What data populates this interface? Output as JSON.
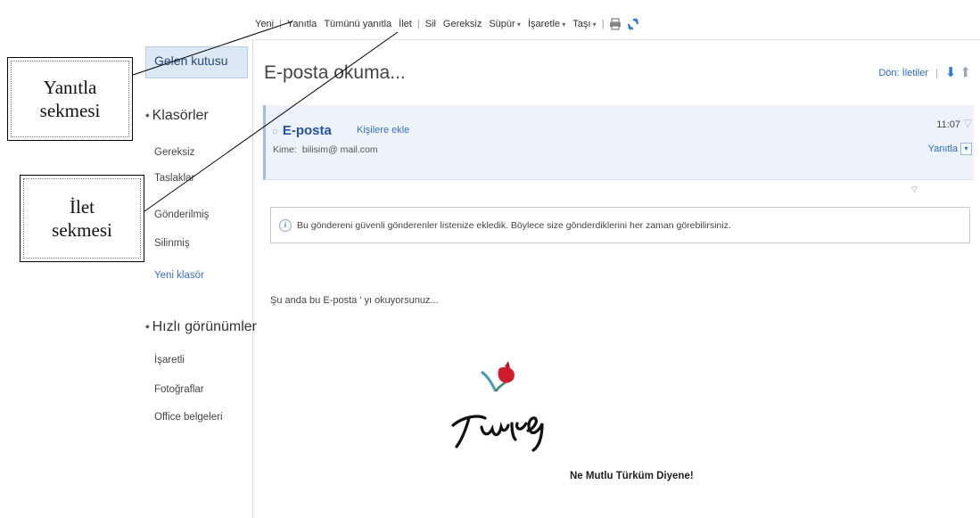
{
  "toolbar": {
    "items": [
      {
        "label": "Yeni",
        "dropdown": false
      },
      {
        "label": "Yanıtla",
        "dropdown": false
      },
      {
        "label": "Tümünü yanıtla",
        "dropdown": false
      },
      {
        "label": "İlet",
        "dropdown": false
      },
      {
        "label": "Sil",
        "dropdown": false
      },
      {
        "label": "Gereksiz",
        "dropdown": false
      },
      {
        "label": "Süpür",
        "dropdown": true
      },
      {
        "label": "İşaretle",
        "dropdown": true
      },
      {
        "label": "Taşı",
        "dropdown": true
      }
    ],
    "icons": [
      "printer-icon",
      "refresh-icon"
    ]
  },
  "nav": {
    "inbox": "Gelen kutusu",
    "folders_header": "Klasörler",
    "folders": [
      "Gereksiz",
      "Taslaklar",
      "Gönderilmiş",
      "Silinmiş"
    ],
    "new_folder": "Yeni klasör",
    "quick_header": "Hızlı görünümler",
    "quick": [
      "İşaretli",
      "Fotoğraflar",
      "Office belgeleri"
    ]
  },
  "main": {
    "title": "E-posta okuma...",
    "details_link": "Dön: İletiler"
  },
  "message": {
    "sender": "E-posta",
    "add_contact": "Kişilere ekle",
    "to_label": "Kime:",
    "to": "bilisim@ mail.com",
    "time": "11:07",
    "reply": "Yanıtla"
  },
  "info": "Bu göndereni güvenli gönderenler listenize ekledik. Böylece size gönderdiklerini her zaman görebilirsiniz.",
  "body": {
    "text": "Şu anda bu E-posta ' yı okuyorsunuz...",
    "slogan": "Ne Mutlu Türküm Diyene!"
  },
  "callouts": {
    "reply_line1": "Yanıtla",
    "reply_line2": "sekmesi",
    "forward_line1": "İlet",
    "forward_line2": "sekmesi"
  },
  "colors": {
    "accent": "#2a6ad3",
    "header_bg": "#edf3fb",
    "inbox_bg": "#dde8f5"
  }
}
